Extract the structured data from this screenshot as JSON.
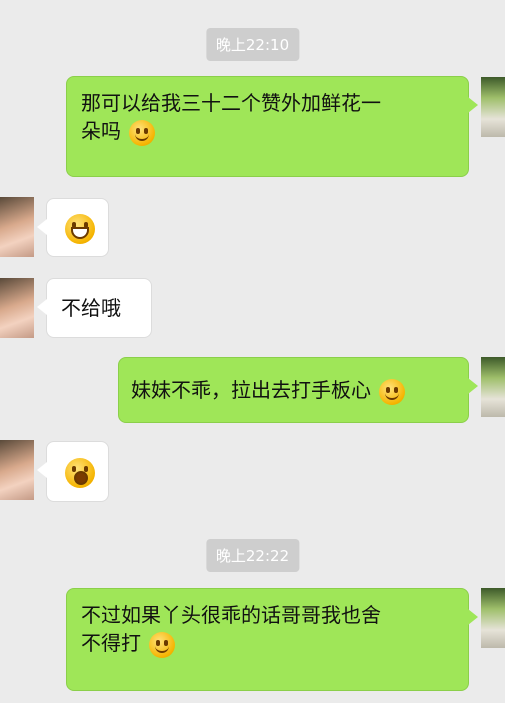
{
  "timestamps": [
    "晚上22:10",
    "晚上22:22"
  ],
  "messages": [
    {
      "side": "out",
      "text": "那可以给我三十二个赞外加鲜花一",
      "text2": "朵吗",
      "emoji": "smile-emoji"
    },
    {
      "side": "in",
      "emoji": "grin-emoji"
    },
    {
      "side": "in",
      "text": "不给哦"
    },
    {
      "side": "out",
      "text": "妹妹不乖，拉出去打手板心",
      "emoji": "smile-emoji"
    },
    {
      "side": "in",
      "emoji": "scream-emoji"
    },
    {
      "side": "out",
      "text": "不过如果丫头很乖的话哥哥我也舍",
      "text2": "不得打",
      "emoji": "smile-emoji"
    }
  ]
}
